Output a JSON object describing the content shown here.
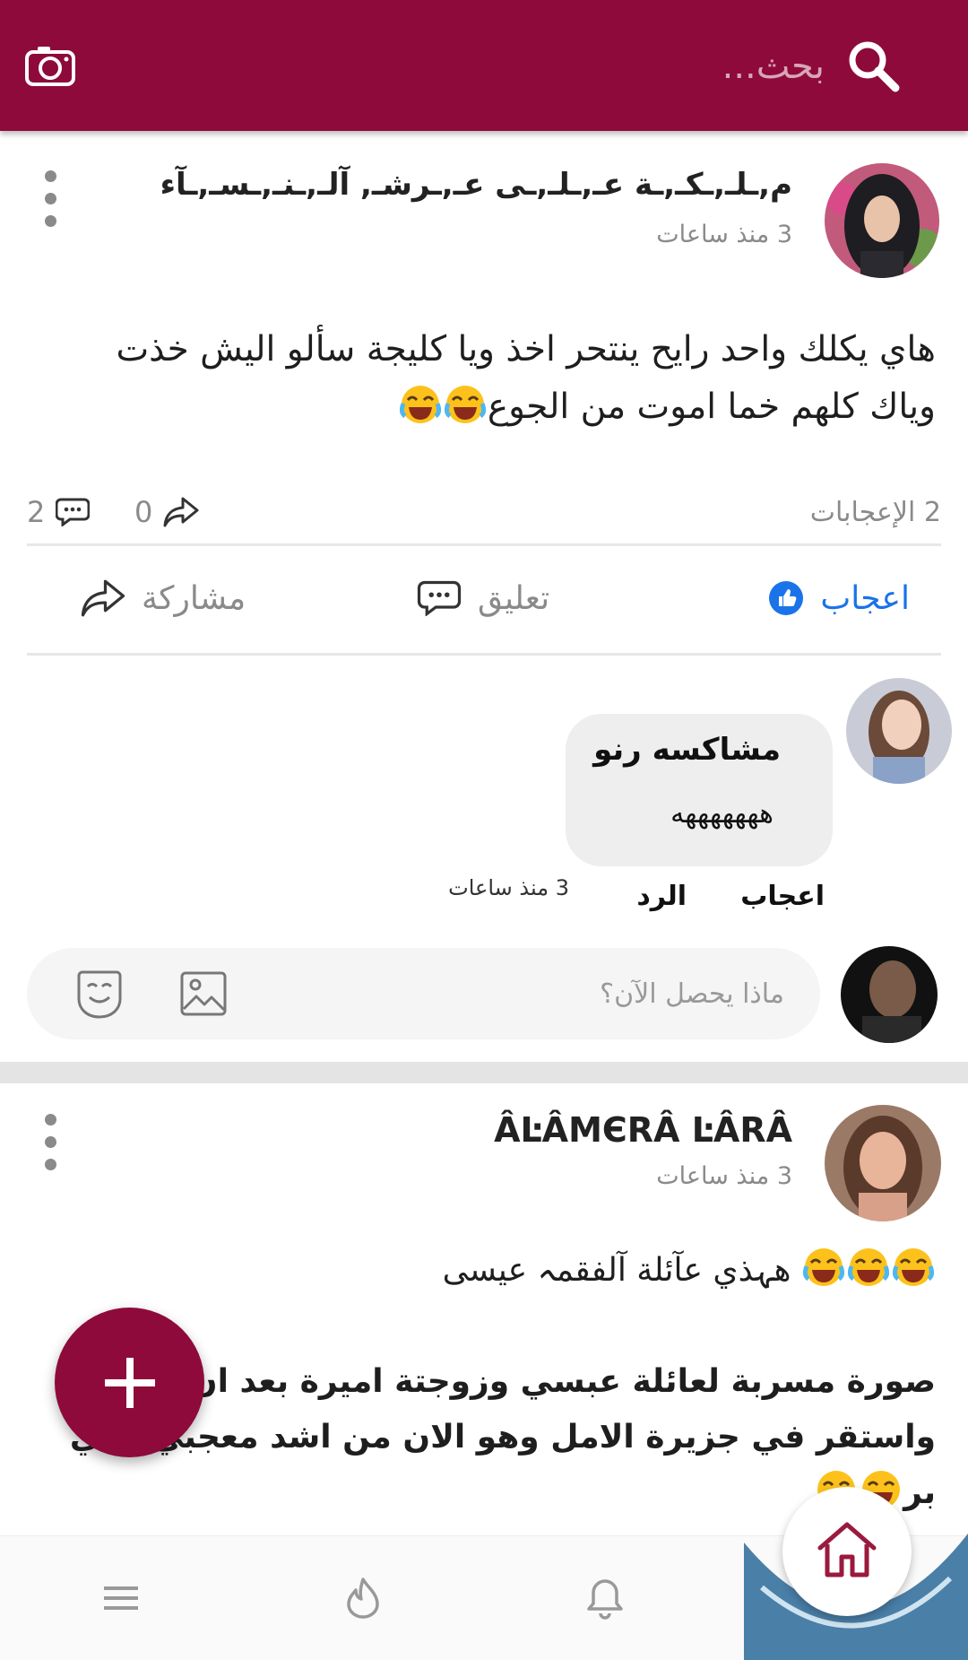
{
  "header": {
    "search_placeholder": "بحث...",
    "brand_color": "#8e0a3a"
  },
  "post1": {
    "author": "م,ـلـ,ـكـ,ـة عـ,ـلـ,ـى عـ,ـرشـ, آلـ,ـنـ,ـسـ,ـآء",
    "time": "3 منذ ساعات",
    "text_line1": "هاي يكلك واحد رايح ينتحر اخذ ويا كليجة سألو اليش خذت",
    "text_line2": "وياك كلهم خما اموت من الجوع",
    "likes": "2 الإعجابات",
    "shares": "0",
    "comments": "2",
    "actions": {
      "like": "اعجاب",
      "comment": "تعليق",
      "share": "مشاركة"
    },
    "comment": {
      "author": "مشاكسه رنو",
      "text": "هههههههه",
      "like": "اعجاب",
      "reply": "الرد",
      "time": "3 منذ ساعات"
    }
  },
  "composer": {
    "placeholder": "ماذا يحصل الآن؟"
  },
  "post2": {
    "author": "ÂĿÂМЄRÂ ĿÂRÂ",
    "time": "3 منذ ساعات",
    "text_line1": "هہذي عآئلة آلفقمہ عيسى",
    "text_line2": "صورة مسربة لعائلة عبسي  وزوجتة اميرة بعد ان",
    "text_line3": "واستقر في جزيرة الامل وهو الان من اشد معجبي نادي",
    "text_line4": "بر"
  },
  "bottom_nav": {
    "items": [
      "menu-icon",
      "flame-icon",
      "bell-icon",
      "home-icon"
    ]
  }
}
